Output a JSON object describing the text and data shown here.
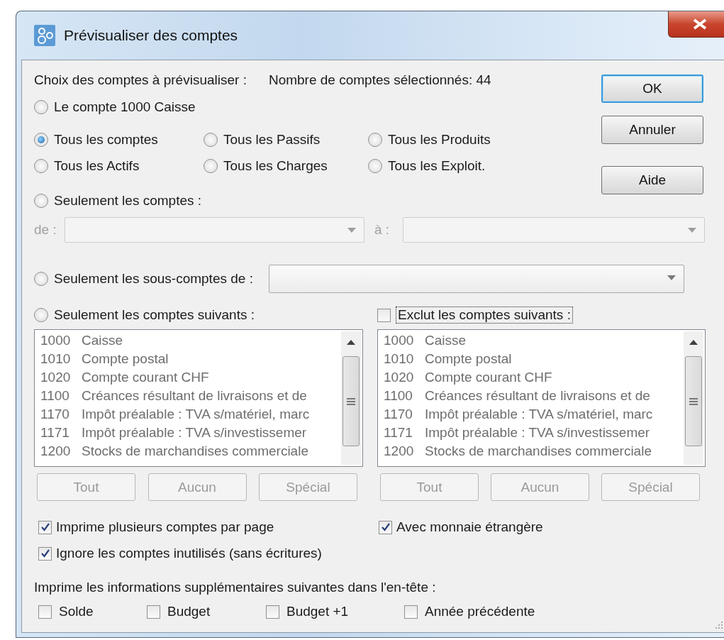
{
  "window": {
    "title": "Prévisualiser des comptes"
  },
  "selection": {
    "label": "Choix des comptes à prévisualiser :",
    "count_label": "Nombre de comptes sélectionnés: 44"
  },
  "buttons": [
    {
      "label": "OK",
      "default": true
    },
    {
      "label": "Annuler",
      "default": false
    },
    {
      "label": "Aide",
      "default": false
    }
  ],
  "account_radio": {
    "label": "Le compte  1000  Caisse",
    "selected": false
  },
  "group_radios": [
    {
      "label": "Tous les comptes",
      "selected": true
    },
    {
      "label": "Tous les Passifs",
      "selected": false
    },
    {
      "label": "Tous les Produits",
      "selected": false
    },
    {
      "label": "Tous les Actifs",
      "selected": false
    },
    {
      "label": "Tous les Charges",
      "selected": false
    },
    {
      "label": "Tous les Exploit.",
      "selected": false
    }
  ],
  "range": {
    "radio": {
      "label": "Seulement les comptes :",
      "selected": false
    },
    "from_label": "de :",
    "to_label": "à :",
    "disabled": true
  },
  "subaccounts": {
    "radio": {
      "label": "Seulement les sous-comptes de :",
      "selected": false
    },
    "disabled": false
  },
  "include_list": {
    "radio": {
      "label": "Seulement les comptes suivants :",
      "selected": false
    },
    "items": [
      {
        "code": "1000",
        "name": "Caisse"
      },
      {
        "code": "1010",
        "name": "Compte postal"
      },
      {
        "code": "1020",
        "name": "Compte courant CHF"
      },
      {
        "code": "1100",
        "name": "Créances résultant de livraisons et de"
      },
      {
        "code": "1170",
        "name": "Impôt préalable : TVA s/matériel, marc"
      },
      {
        "code": "1171",
        "name": "Impôt préalable : TVA s/investissemer"
      },
      {
        "code": "1200",
        "name": "Stocks de marchandises commerciale"
      }
    ],
    "disabled": true,
    "buttons": [
      {
        "label": "Tout",
        "disabled": true
      },
      {
        "label": "Aucun",
        "disabled": true
      },
      {
        "label": "Spécial",
        "disabled": true
      }
    ]
  },
  "exclude_list": {
    "checkbox": {
      "label": "Exclut les comptes suivants :",
      "checked": false,
      "focused": true
    },
    "items": [
      {
        "code": "1000",
        "name": "Caisse"
      },
      {
        "code": "1010",
        "name": "Compte postal"
      },
      {
        "code": "1020",
        "name": "Compte courant CHF"
      },
      {
        "code": "1100",
        "name": "Créances résultant de livraisons et de"
      },
      {
        "code": "1170",
        "name": "Impôt préalable : TVA s/matériel, marc"
      },
      {
        "code": "1171",
        "name": "Impôt préalable : TVA s/investissemer"
      },
      {
        "code": "1200",
        "name": "Stocks de marchandises commerciale"
      }
    ],
    "disabled": true,
    "buttons": [
      {
        "label": "Tout",
        "disabled": true
      },
      {
        "label": "Aucun",
        "disabled": true
      },
      {
        "label": "Spécial",
        "disabled": true
      }
    ]
  },
  "options": [
    {
      "label": "Imprime plusieurs comptes par page",
      "checked": true
    },
    {
      "label": "Avec monnaie étrangère",
      "checked": true
    },
    {
      "label": "Ignore les comptes inutilisés (sans écritures)",
      "checked": true
    }
  ],
  "header_info": {
    "label": "Imprime les informations supplémentaires suivantes dans l'en-tête :",
    "checkboxes": [
      {
        "label": "Solde",
        "checked": false
      },
      {
        "label": "Budget",
        "checked": false
      },
      {
        "label": "Budget +1",
        "checked": false
      },
      {
        "label": "Année précédente",
        "checked": false
      }
    ]
  }
}
